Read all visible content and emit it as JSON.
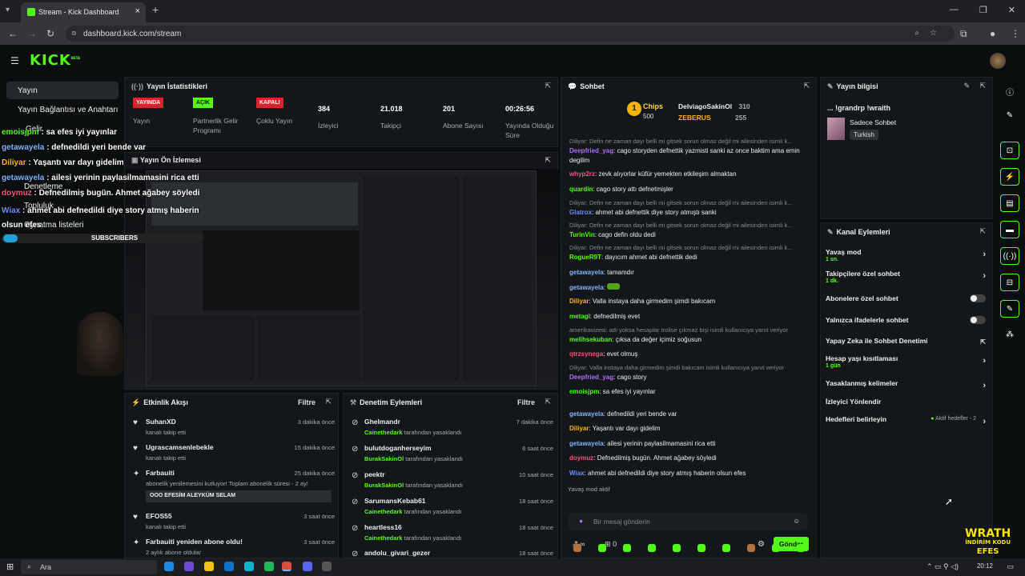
{
  "browser": {
    "tab_title": "Stream - Kick Dashboard",
    "url": "dashboard.kick.com/stream"
  },
  "sidebar": {
    "items": [
      {
        "label": "Yayın"
      },
      {
        "label": "Yayın Bağlantısı ve Anahtarı"
      },
      {
        "label": "Gelir"
      },
      {
        "label": "Denetleme"
      },
      {
        "label": "Topluluk"
      },
      {
        "label": "Oynatma listeleri"
      }
    ]
  },
  "stats": {
    "title": "Yayın İstatistikleri",
    "items": [
      {
        "badge": "YAYINDA",
        "label": "Yayın",
        "badge_color": "#d8242b"
      },
      {
        "badge": "AÇIK",
        "label": "Partnerlik Gelir Programı",
        "badge_color": "#53fc18"
      },
      {
        "badge": "KAPALI",
        "label": "Çoklu Yayın",
        "badge_color": "#d8242b"
      },
      {
        "value": "384",
        "label": "İzleyici"
      },
      {
        "value": "21.018",
        "label": "Takipçi"
      },
      {
        "value": "201",
        "label": "Abone Sayısı"
      },
      {
        "value": "00:26:56",
        "label": "Yayında Olduğu Süre"
      }
    ]
  },
  "preview": {
    "title": "Yayın Ön İzlemesi"
  },
  "overlay": {
    "lines": [
      {
        "user": "emoisjpm",
        "text": "sa efes iyi yayınlar"
      },
      {
        "user": "getawayela",
        "text": "defnedildi yeri bende var"
      },
      {
        "user": "Diliyar",
        "text": "Yaşantı var dayı gidelim"
      },
      {
        "user": "getawayela",
        "text": "ailesi yerinin paylasilmamasini rica etti"
      },
      {
        "user": "doymuz",
        "text": "Defnedilmiş bugün. Ahmet ağabey söyledi"
      },
      {
        "user": "Wiax",
        "text": "ahmet abi defnedildi diye story atmış haberin olsun efes"
      }
    ],
    "subs_label": "SUBSCRIBERS"
  },
  "activity": {
    "title": "Etkinlik Akışı",
    "filter": "Filtre",
    "items": [
      {
        "name": "SuhanXD",
        "sub": "kanalı takip etti",
        "time": "3 dakika önce"
      },
      {
        "name": "Ugrascamsenlebekle",
        "sub": "kanalı takip etti",
        "time": "15 dakika önce"
      },
      {
        "name": "Farbauiti",
        "sub": "abonelik yenilemesini kutluyor! Toplam abonelik süresi - 2 ay!",
        "time": "25 dakika önce",
        "message": "OOO EFESİM ALEYKÜM SELAM"
      },
      {
        "name": "EFOS55",
        "sub": "kanalı takip etti",
        "time": "3 saat önce"
      },
      {
        "name": "Farbauiti yeniden abone oldu!",
        "sub": "2 aylık abone oldular",
        "time": "3 saat önce"
      }
    ]
  },
  "moderation": {
    "title": "Denetim Eylemleri",
    "filter": "Filtre",
    "items": [
      {
        "name": "Ghelmandr",
        "by": "Cainethedark",
        "suffix": "tarafından yasaklandı",
        "time": "7 dakika önce"
      },
      {
        "name": "bulutdoganherseyim",
        "by": "BurakSakinOl",
        "suffix": "tarafından yasaklandı",
        "time": "6 saat önce"
      },
      {
        "name": "peektr",
        "by": "BurakSakinOl",
        "suffix": "tarafından yasaklandı",
        "time": "10 saat önce"
      },
      {
        "name": "SarumansKebab61",
        "by": "Cainethedark",
        "suffix": "tarafından yasaklandı",
        "time": "18 saat önce"
      },
      {
        "name": "heartless16",
        "by": "Cainethedark",
        "suffix": "tarafından yasaklandı",
        "time": "18 saat önce"
      },
      {
        "name": "andolu_givari_gezer",
        "by": "",
        "suffix": "",
        "time": "18 saat önce"
      }
    ]
  },
  "chat": {
    "title": "Sohbet",
    "top": {
      "label": "Chips",
      "count1": "500",
      "user1": "DelviagoSakinOl",
      "v1": "310",
      "user2": "ZEBERUS",
      "v2": "255"
    },
    "lines": [
      {
        "ctx": "Diliyar: Defin ne zaman dayı belli mi gitsek sorun olmaz değil mi ailesinden isimli k...",
        "user": "Deepfried_yag",
        "text": "cago storyden defnettik yazmisti sanki az once baktim ama emin degilim",
        "color": "#b26bff"
      },
      {
        "user": "whyp2rz",
        "text": "zevk alıyorlar küfür yemekten etkileşim almaktan",
        "color": "#ff4f7b"
      },
      {
        "user": "quardin",
        "text": "cago story attı defnetmişler",
        "color": "#53fc18"
      },
      {
        "ctx": "Diliyar: Defin ne zaman dayı belli mi gitsek sorun olmaz değil mi ailesinden isimli k...",
        "user": "Glatrox",
        "text": "ahmet abi defnettik diye story atmıştı sanki",
        "color": "#6b8cff"
      },
      {
        "ctx": "Diliyar: Defin ne zaman dayı belli mi gitsek sorun olmaz değil mi ailesinden isimli k...",
        "user": "TurinVin",
        "text": "cago defin oldu dedi",
        "color": "#53fc18"
      },
      {
        "ctx": "Diliyar: Defin ne zaman dayı belli mi gitsek sorun olmaz değil mi ailesinden isimli k...",
        "user": "RogueR9T",
        "text": "dayıcım ahmet abi defnettik dedi",
        "color": "#53fc18"
      },
      {
        "user": "getawayela",
        "text": "tamamdır",
        "color": "#7fb4ff"
      },
      {
        "user": "getawayela",
        "text": "",
        "color": "#7fb4ff"
      },
      {
        "user": "Diliyar",
        "text": "Valla instaya daha girmedim şimdi bakıcam",
        "color": "#ffb319"
      },
      {
        "user": "metagi",
        "text": "defnedilmiş evet",
        "color": "#53fc18"
      },
      {
        "ctx": "amerikavizesi: adı yoksa hesaplar trollse çıkmaz bişi isimli kullanıcıya yanıt veriyor",
        "user": "melihsekuban",
        "text": "çıksa da değer içimiz soğusun",
        "color": "#53fc18"
      },
      {
        "user": "qtrzsynega",
        "text": "evet olmuş",
        "color": "#ff4f7b"
      },
      {
        "ctx": "Diliyar: Valla instaya daha girmedim şimdi bakıcam isimli kullanıcıya yanıt veriyor",
        "user": "Deepfried_yag",
        "text": "cago story",
        "color": "#b26bff"
      },
      {
        "user": "emoisjpm",
        "text": "sa efes iyi yayınlar",
        "color": "#53fc18"
      },
      {
        "user": "getawayela",
        "text": "defnedildi yeri bende var",
        "color": "#7fb4ff"
      },
      {
        "user": "Diliyar",
        "text": "Yaşantı var dayı gidelim",
        "color": "#ffb319"
      },
      {
        "user": "getawayela",
        "text": "ailesi yerinin paylasilmamasini rica etti",
        "color": "#7fb4ff"
      },
      {
        "user": "doymuz",
        "text": "Defnedilmiş bugün. Ahmet ağabey söyledi",
        "color": "#ff4f7b"
      },
      {
        "user": "Wiax",
        "text": "ahmet abi defnedildi diye story atmış haberin olsun efes",
        "color": "#6b8cff"
      }
    ],
    "slow_mode": "Yavaş mod aktif",
    "placeholder": "Bir mesaj gönderin",
    "count": "0",
    "send": "Gönder"
  },
  "info": {
    "title": "Yayın bilgisi",
    "stream_title": "... !grandrp !wraith",
    "category": "Sadece Sohbet",
    "language": "Turkish"
  },
  "actions": {
    "title": "Kanal Eylemleri",
    "items": [
      {
        "label": "Yavaş mod",
        "sub": "1 sn.",
        "kind": "arrow"
      },
      {
        "label": "Takipçilere özel sohbet",
        "sub": "1 dk.",
        "kind": "arrow"
      },
      {
        "label": "Abonelere özel sohbet",
        "kind": "toggle"
      },
      {
        "label": "Yalnızca ifadelerle sohbet",
        "kind": "toggle"
      },
      {
        "label": "Yapay Zeka ile Sohbet Denetimi",
        "kind": "ext"
      },
      {
        "label": "Hesap yaşı kısıtlaması",
        "sub": "1 gün",
        "kind": "arrow"
      },
      {
        "label": "Yasaklanmış kelimeler",
        "kind": "arrow"
      },
      {
        "label": "İzleyici Yönlendir",
        "kind": "none"
      },
      {
        "label": "Hedefleri belirleyin",
        "extra": "Aktif hedefler - 2",
        "kind": "arrow"
      }
    ]
  },
  "taskbar": {
    "search": "Ara",
    "time": "20:12"
  },
  "watermark": {
    "top": "WRATH",
    "mid": "İNDİRİM KODU",
    "bot": "EFES"
  },
  "colors": {
    "accent": "#53fc18",
    "bg": "#0b0e0f",
    "card": "#141719",
    "live": "#d8242b"
  }
}
